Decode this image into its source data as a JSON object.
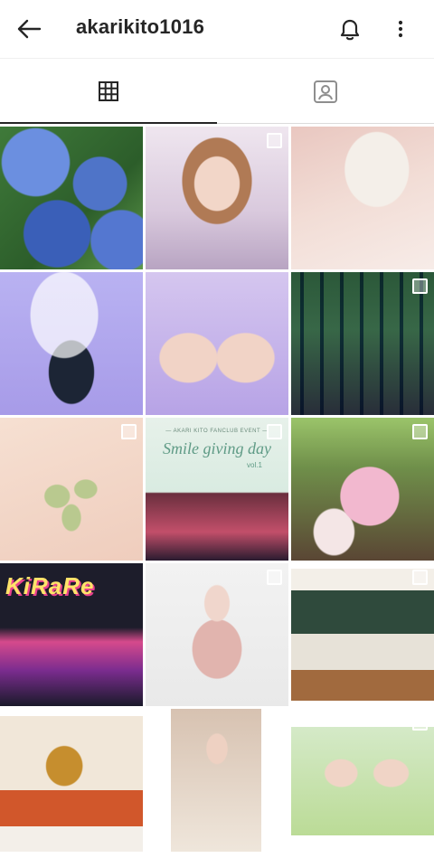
{
  "header": {
    "username": "akarikito1016",
    "back_icon": "arrow-left-icon",
    "bell_icon": "bell-icon",
    "more_icon": "more-vertical-icon"
  },
  "tabs": [
    {
      "icon": "grid-icon",
      "active": true
    },
    {
      "icon": "tagged-person-icon",
      "active": false
    }
  ],
  "posts": [
    {
      "multi": false
    },
    {
      "multi": true
    },
    {
      "multi": false
    },
    {
      "multi": false
    },
    {
      "multi": false
    },
    {
      "multi": true
    },
    {
      "multi": true
    },
    {
      "multi": true,
      "text_small": "— AKARI KITO FANCLUB EVENT —",
      "text_big": "Smile giving day",
      "text_vol": "vol.1"
    },
    {
      "multi": true
    },
    {
      "multi": false,
      "text_brand": "KiRaRe"
    },
    {
      "multi": true
    },
    {
      "multi": true
    },
    {
      "multi": false
    },
    {
      "multi": false
    },
    {
      "multi": true
    }
  ],
  "colors": {
    "text": "#262626",
    "divider": "#efefef",
    "tab_inactive_line": "#dbdbdb",
    "background": "#ffffff"
  }
}
